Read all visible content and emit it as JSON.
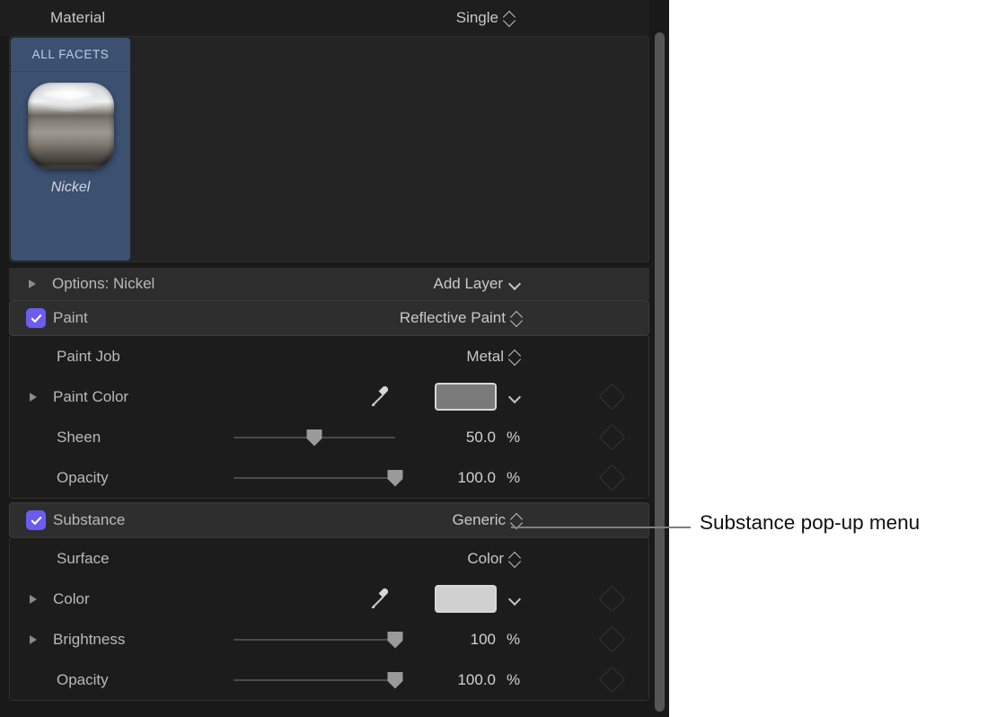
{
  "panel": {
    "header": {
      "title": "Material",
      "mode_value": "Single",
      "mode_icon": "chevron-up-down-icon"
    },
    "facet_browser": {
      "tile": {
        "badge": "ALL FACETS",
        "material_name": "Nickel",
        "thumbnail_icon": "nickel-material-thumbnail",
        "selected_color": "#3c5170"
      }
    },
    "options_row": {
      "disclosure_icon": "disclosure-triangle-collapsed-icon",
      "label": "Options: Nickel",
      "add_layer_label": "Add Layer",
      "add_layer_icon": "chevron-down-icon"
    },
    "sections": [
      {
        "name": "paint",
        "checked": true,
        "label": "Paint",
        "value": "Reflective Paint",
        "value_icon": "chevron-up-down-icon",
        "rows": [
          {
            "kind": "popup",
            "label": "Paint Job",
            "value": "Metal",
            "value_icon": "chevron-up-down-icon",
            "disclosure": false,
            "keyframe": false
          },
          {
            "kind": "color",
            "label": "Paint Color",
            "disclosure": true,
            "eyedropper_icon": "eyedropper-icon",
            "swatch_color": "#7a7a7a",
            "swatch_icon": "chevron-down-icon",
            "keyframe": true,
            "keyframe_icon": "keyframe-diamond-icon"
          },
          {
            "kind": "slider",
            "label": "Sheen",
            "disclosure": false,
            "value": "50.0",
            "unit": "%",
            "percent": 50,
            "keyframe": true,
            "keyframe_icon": "keyframe-diamond-icon"
          },
          {
            "kind": "slider",
            "label": "Opacity",
            "disclosure": false,
            "value": "100.0",
            "unit": "%",
            "percent": 100,
            "keyframe": true,
            "keyframe_icon": "keyframe-diamond-icon"
          }
        ]
      },
      {
        "name": "substance",
        "checked": true,
        "label": "Substance",
        "value": "Generic",
        "value_icon": "chevron-up-down-icon",
        "rows": [
          {
            "kind": "popup",
            "label": "Surface",
            "value": "Color",
            "value_icon": "chevron-up-down-icon",
            "disclosure": false,
            "keyframe": false
          },
          {
            "kind": "color",
            "label": "Color",
            "disclosure": true,
            "eyedropper_icon": "eyedropper-icon",
            "swatch_color": "#d0d0d0",
            "swatch_icon": "chevron-down-icon",
            "keyframe": true,
            "keyframe_icon": "keyframe-diamond-icon"
          },
          {
            "kind": "slider",
            "label": "Brightness",
            "disclosure": true,
            "value": "100",
            "unit": "%",
            "percent": 100,
            "keyframe": true,
            "keyframe_icon": "keyframe-diamond-icon"
          },
          {
            "kind": "slider",
            "label": "Opacity",
            "disclosure": false,
            "value": "100.0",
            "unit": "%",
            "percent": 100,
            "keyframe": true,
            "keyframe_icon": "keyframe-diamond-icon"
          }
        ]
      }
    ],
    "scrollbar": {
      "name": "vertical-scrollbar"
    }
  },
  "callout": {
    "label": "Substance pop-up menu"
  },
  "colors": {
    "checkbox_accent": "#6b5cf0",
    "panel_background": "#191919",
    "row_background": "#1c1c1c",
    "section_header_background": "#2e2e2e",
    "facet_selected": "#3c5170"
  }
}
